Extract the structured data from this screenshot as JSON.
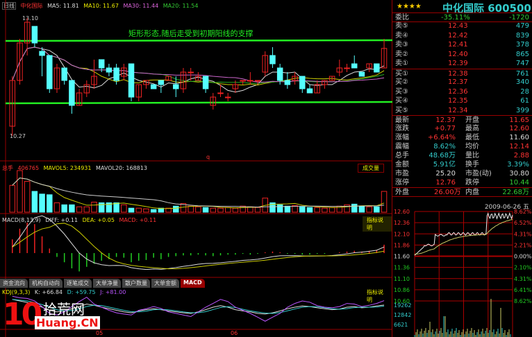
{
  "header": {
    "period": "日线",
    "stock": "中化国际",
    "ma5": "MA5: 11.81",
    "ma10": "MA10: 11.67",
    "ma30": "MA30: 11.44",
    "ma20": "MA20: 11.54",
    "high_mark": "13.10",
    "low_mark": "10.27",
    "annotation": "矩形形态,随后走受到初期阳线的支撑",
    "cursor_mark": "q"
  },
  "volume": {
    "label": "总手",
    "value": "406765",
    "mavol5": "MAVOL5: 234931",
    "mavol20": "MAVOL20: 168813",
    "button": "成交量"
  },
  "macd": {
    "label": "MACD(8,13,9)",
    "diff": "DIFF: +0.11",
    "dea": "DEA: +0.05",
    "macd": "MACD: +0.11",
    "button": "指标说明"
  },
  "tabs": [
    "资金流向",
    "机构自动向",
    "逐笔成交",
    "大单净量",
    "散户数量",
    "大单金额",
    "MACD"
  ],
  "kdj": {
    "label": "KDJ(9,3,3)",
    "k": "K: +66.84",
    "d": "D: +59.75",
    "j": "J: +81.00",
    "button": "指标说明"
  },
  "date_axis": [
    "05",
    "06"
  ],
  "watermark": {
    "number": "10",
    "cn": "拾荒网",
    "en": "Huang.CN"
  },
  "quote": {
    "stars": "★★★★",
    "title": "中化国际 600500",
    "weibi": {
      "label": "委比",
      "pct": "-35.11%",
      "diff": "-1720"
    },
    "sell": [
      {
        "label": "卖⑤",
        "price": "12.43",
        "vol": "479"
      },
      {
        "label": "卖④",
        "price": "12.42",
        "vol": "839"
      },
      {
        "label": "卖③",
        "price": "12.41",
        "vol": "378"
      },
      {
        "label": "卖②",
        "price": "12.40",
        "vol": "865"
      },
      {
        "label": "卖①",
        "price": "12.39",
        "vol": "747"
      }
    ],
    "buy": [
      {
        "label": "买①",
        "price": "12.38",
        "vol": "761"
      },
      {
        "label": "买②",
        "price": "12.37",
        "vol": "340"
      },
      {
        "label": "买③",
        "price": "12.36",
        "vol": "28"
      },
      {
        "label": "买④",
        "price": "12.35",
        "vol": "61"
      },
      {
        "label": "买⑤",
        "price": "12.34",
        "vol": "399"
      }
    ],
    "stats": [
      {
        "l1": "最新",
        "v1": "12.37",
        "c1": "#f33",
        "l2": "开盘",
        "v2": "11.65",
        "c2": "#f33"
      },
      {
        "l1": "涨跌",
        "v1": "+0.77",
        "c1": "#f33",
        "l2": "最高",
        "v2": "12.60",
        "c2": "#f33"
      },
      {
        "l1": "涨幅",
        "v1": "+6.64%",
        "c1": "#f33",
        "l2": "最低",
        "v2": "11.60",
        "c2": "#ddd"
      },
      {
        "l1": "震幅",
        "v1": "8.62%",
        "c1": "#3cc",
        "l2": "均价",
        "v2": "12.14",
        "c2": "#f33"
      },
      {
        "l1": "总手",
        "v1": "48.68万",
        "c1": "#3cc",
        "l2": "量比",
        "v2": "2.88",
        "c2": "#f33"
      },
      {
        "l1": "金额",
        "v1": "5.91亿",
        "c1": "#3cc",
        "l2": "换手",
        "v2": "3.39%",
        "c2": "#3cc"
      },
      {
        "l1": "市盈",
        "v1": "25.20",
        "c1": "#ddd",
        "l2": "市盈(动)",
        "v2": "30.80",
        "c2": "#ddd"
      },
      {
        "l1": "涨停",
        "v1": "12.76",
        "c1": "#f33",
        "l2": "跌停",
        "v2": "10.44",
        "c2": "#3c3"
      }
    ],
    "outer": {
      "l1": "外盘",
      "v1": "26.00万",
      "l2": "内盘",
      "v2": "22.68万"
    },
    "date": "2009-06-26 五",
    "intraday_left": [
      "12.60",
      "12.36",
      "12.10",
      "11.86",
      "11.60",
      "11.36",
      "11.10",
      "10.86",
      "10.60"
    ],
    "intraday_right": [
      "8.62%",
      "6.52%",
      "4.31%",
      "2.21%",
      "0.00%",
      "2.10%",
      "4.31%",
      "6.41%",
      "8.62%"
    ],
    "intraday_vol": [
      "19262",
      "12842",
      "6621"
    ]
  },
  "chart_data": {
    "type": "candlestick",
    "ohlc": [
      [
        10.5,
        11.7,
        10.27,
        11.6
      ],
      [
        11.6,
        12.6,
        11.5,
        12.5
      ],
      [
        12.5,
        13.1,
        12.2,
        13.0
      ],
      [
        12.9,
        12.9,
        12.4,
        12.5
      ],
      [
        12.3,
        12.4,
        11.7,
        12.2
      ],
      [
        12.2,
        12.2,
        11.3,
        11.4
      ],
      [
        11.4,
        12.0,
        11.3,
        11.9
      ],
      [
        11.9,
        11.9,
        11.5,
        11.6
      ],
      [
        11.6,
        11.6,
        10.8,
        11.0
      ],
      [
        11.0,
        11.4,
        11.0,
        11.3
      ],
      [
        11.3,
        11.6,
        11.2,
        11.5
      ],
      [
        11.5,
        12.1,
        11.4,
        11.7
      ],
      [
        12.1,
        12.1,
        11.8,
        11.9
      ],
      [
        11.9,
        12.0,
        11.7,
        11.8
      ],
      [
        11.9,
        12.0,
        11.5,
        11.6
      ],
      [
        11.7,
        12.0,
        11.6,
        11.9
      ],
      [
        12.0,
        12.0,
        11.1,
        11.2
      ],
      [
        11.2,
        11.5,
        11.1,
        11.5
      ],
      [
        11.5,
        11.6,
        11.4,
        11.6
      ],
      [
        11.5,
        11.5,
        11.4,
        11.4
      ],
      [
        11.6,
        11.6,
        11.3,
        11.5
      ],
      [
        11.6,
        11.7,
        11.6,
        11.7
      ],
      [
        11.5,
        11.7,
        11.2,
        11.4
      ],
      [
        11.4,
        11.9,
        11.3,
        11.8
      ],
      [
        11.8,
        11.9,
        11.6,
        11.8
      ],
      [
        11.6,
        11.8,
        11.6,
        11.7
      ],
      [
        11.7,
        11.7,
        11.3,
        11.4
      ],
      [
        11.0,
        11.3,
        10.9,
        11.2
      ],
      [
        11.3,
        11.5,
        11.2,
        11.3
      ],
      [
        11.2,
        11.3,
        11.1,
        11.2
      ],
      [
        11.4,
        11.6,
        11.3,
        11.5
      ],
      [
        11.6,
        11.6,
        11.5,
        11.6
      ],
      [
        11.6,
        11.8,
        11.5,
        11.6
      ],
      [
        11.6,
        11.6,
        11.5,
        11.6
      ],
      [
        11.8,
        12.3,
        11.7,
        12.2
      ],
      [
        12.2,
        12.4,
        11.9,
        12.0
      ],
      [
        11.9,
        12.0,
        11.5,
        11.6
      ],
      [
        11.6,
        11.8,
        11.4,
        11.5
      ],
      [
        11.6,
        11.8,
        11.5,
        11.7
      ],
      [
        11.7,
        11.7,
        11.3,
        11.4
      ],
      [
        11.4,
        11.5,
        11.3,
        11.3
      ],
      [
        11.3,
        11.6,
        11.3,
        11.5
      ],
      [
        11.5,
        11.6,
        11.4,
        11.6
      ],
      [
        11.6,
        11.7,
        11.6,
        11.7
      ],
      [
        11.8,
        12.1,
        11.7,
        11.9
      ],
      [
        11.9,
        12.0,
        11.8,
        11.9
      ],
      [
        12.0,
        12.2,
        11.9,
        11.9
      ],
      [
        11.8,
        11.8,
        11.7,
        11.7
      ],
      [
        11.9,
        12.0,
        11.8,
        12.0
      ],
      [
        12.0,
        12.0,
        11.8,
        11.8
      ],
      [
        11.9,
        12.6,
        11.9,
        12.37
      ]
    ],
    "support_lines": [
      12.55,
      11.05
    ],
    "volume": [
      400,
      620,
      460,
      310,
      270,
      260,
      140,
      110,
      110,
      80,
      80,
      150,
      140,
      140,
      140,
      110,
      60,
      60,
      50,
      40,
      60,
      60,
      90,
      130,
      90,
      80,
      70,
      60,
      60,
      70,
      60,
      90,
      80,
      70,
      210,
      140,
      110,
      90,
      100,
      80,
      70,
      70,
      60,
      70,
      90,
      110,
      120,
      90,
      80,
      80,
      310
    ],
    "macd_hist": [
      0.18,
      0.32,
      0.4,
      0.38,
      0.22,
      0.06,
      -0.05,
      -0.12,
      -0.2,
      -0.24,
      -0.18,
      -0.14,
      -0.1,
      -0.08,
      -0.05,
      -0.06,
      -0.12,
      -0.1,
      -0.09,
      -0.06,
      -0.08,
      -0.05,
      -0.04,
      -0.03,
      -0.03,
      -0.02,
      -0.03,
      -0.04,
      -0.03,
      -0.02,
      -0.02,
      -0.01,
      -0.02,
      -0.01,
      0.01,
      0.02,
      0.01,
      -0.01,
      -0.01,
      -0.02,
      -0.02,
      -0.01,
      -0.01,
      0.0,
      0.01,
      0.02,
      0.03,
      0.02,
      0.03,
      0.04,
      0.11
    ],
    "kdj_k": [
      85,
      80,
      75,
      70,
      60,
      50,
      45,
      48,
      55,
      62,
      70,
      66,
      60,
      55,
      50,
      45,
      42,
      48,
      52,
      55,
      52,
      48,
      45,
      42,
      40,
      45,
      52,
      60,
      65,
      60,
      52,
      48,
      45,
      40,
      38,
      42,
      48,
      55,
      60,
      64,
      62,
      58,
      55,
      52,
      54,
      60,
      62,
      58,
      60,
      64,
      66.84
    ],
    "kdj_j": [
      95,
      90,
      88,
      80,
      62,
      40,
      35,
      45,
      62,
      78,
      92,
      70,
      60,
      50,
      42,
      38,
      35,
      50,
      55,
      62,
      56,
      45,
      40,
      35,
      30,
      45,
      60,
      72,
      85,
      78,
      60,
      50,
      40,
      28,
      15,
      28,
      40,
      60,
      72,
      80,
      76,
      65,
      60,
      58,
      62,
      72,
      70,
      62,
      66,
      72,
      81.0
    ]
  }
}
